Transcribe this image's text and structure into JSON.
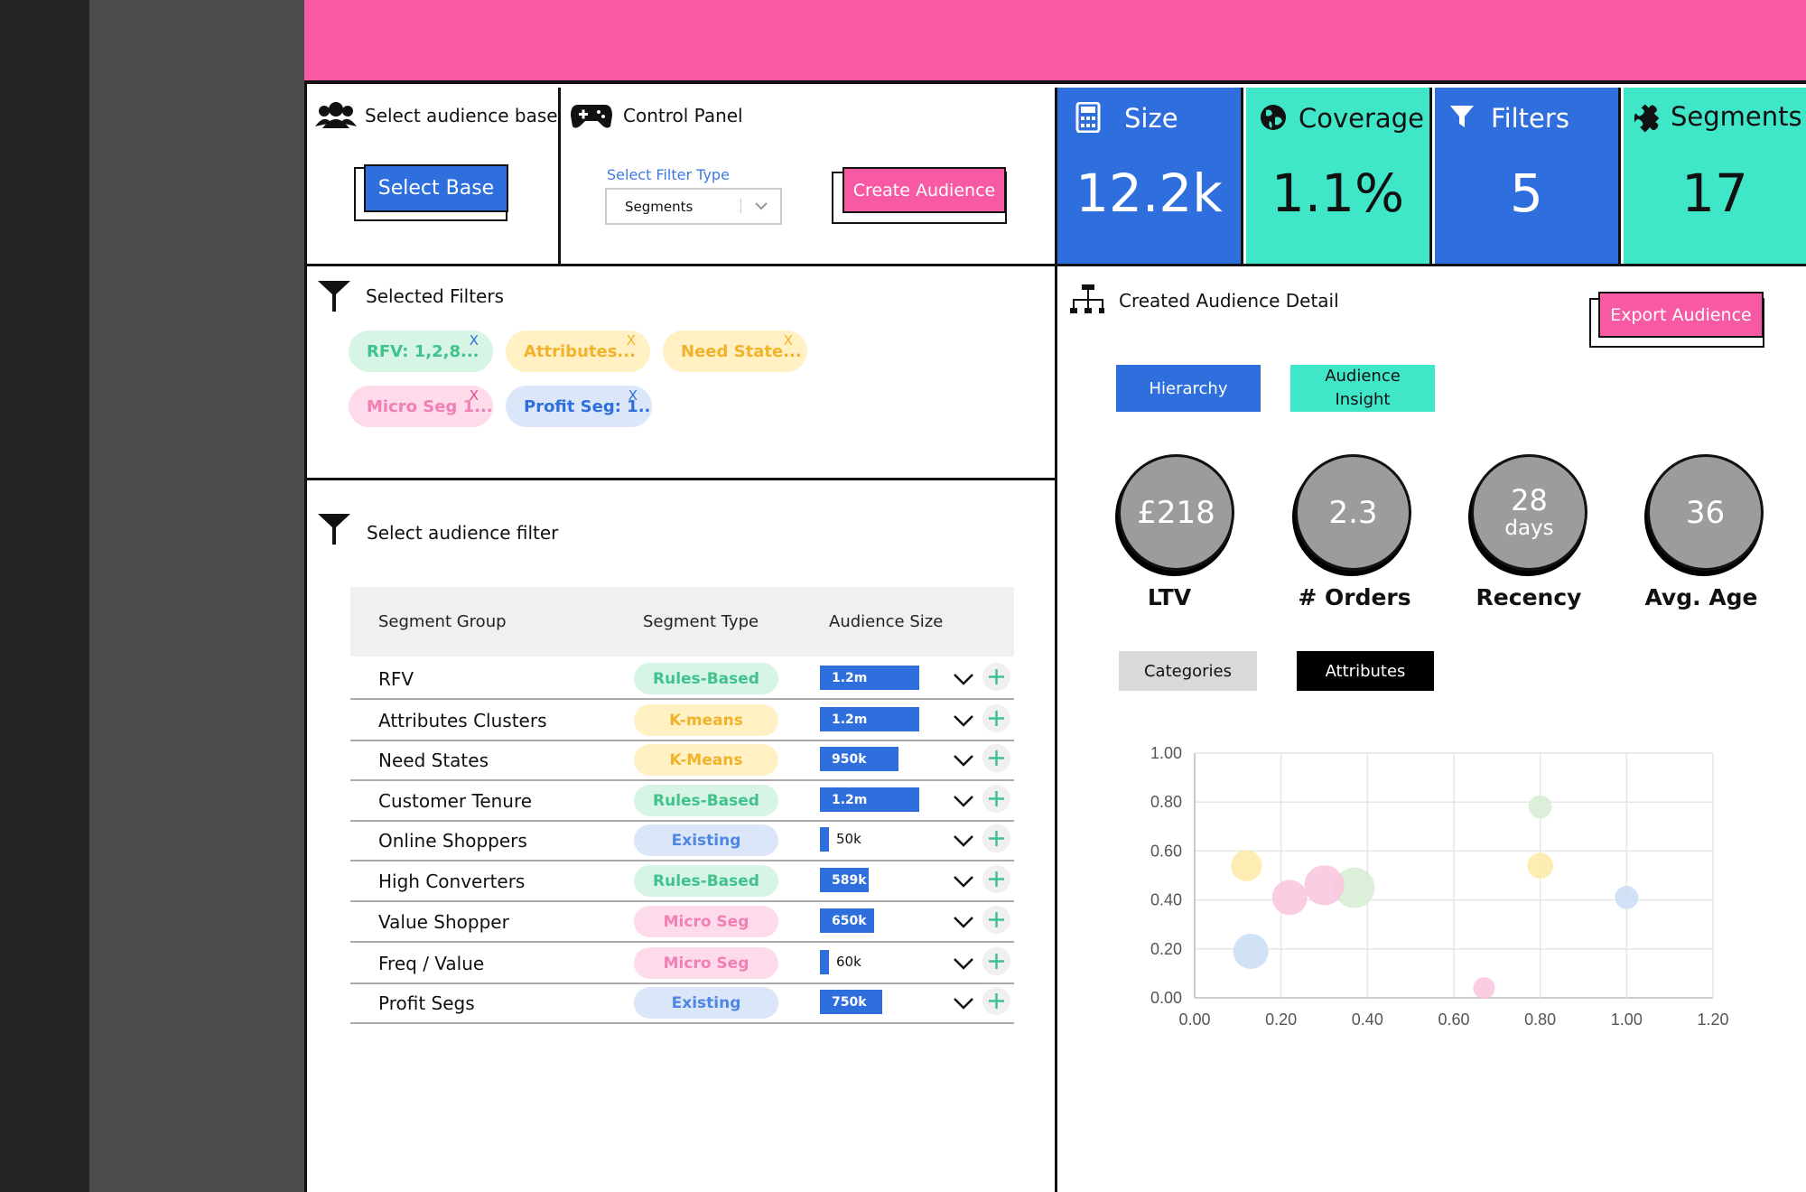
{
  "colors": {
    "accent_pink": "#f75aa3",
    "accent_blue": "#2f6fdd",
    "accent_teal": "#40e6c8",
    "green_pill": "#d7f5e4",
    "yellow_pill": "#fff1c4",
    "pink_pill": "#fddbeb",
    "blue_pill": "#dbe7f8"
  },
  "audience_base": {
    "title": "Select audience base",
    "icon": "users-icon",
    "button": "Select Base"
  },
  "control_panel": {
    "title": "Control Panel",
    "icon": "gamepad-icon",
    "filter_label": "Select Filter Type",
    "filter_value": "Segments",
    "button": "Create Audience"
  },
  "kpis": [
    {
      "label": "Size",
      "value": "12.2k",
      "icon": "calculator-icon"
    },
    {
      "label": "Coverage",
      "value": "1.1%",
      "icon": "globe-icon"
    },
    {
      "label": "Filters",
      "value": "5",
      "icon": "filter-icon"
    },
    {
      "label": "Segments",
      "value": "17",
      "icon": "puzzle-icon"
    }
  ],
  "selected_filters": {
    "title": "Selected Filters",
    "chips": [
      {
        "label": "RFV: 1,2,8...",
        "remove": "X"
      },
      {
        "label": "Attributes...",
        "remove": "X"
      },
      {
        "label": "Need State...",
        "remove": "X"
      },
      {
        "label": "Micro Seg 1...",
        "remove": "X"
      },
      {
        "label": "Profit Seg: 1..",
        "remove": "X"
      }
    ]
  },
  "audience_filter": {
    "title": "Select audience filter",
    "columns": [
      "Segment Group",
      "Segment Type",
      "Audience Size"
    ],
    "rows": [
      {
        "group": "RFV",
        "type": "Rules-Based",
        "size": "1.2m",
        "size_value": 1.2
      },
      {
        "group": "Attributes Clusters",
        "type": "K-means",
        "size": "1.2m",
        "size_value": 1.2
      },
      {
        "group": "Need States",
        "type": "K-Means",
        "size": "950k",
        "size_value": 0.95
      },
      {
        "group": "Customer Tenure",
        "type": "Rules-Based",
        "size": "1.2m",
        "size_value": 1.2
      },
      {
        "group": "Online Shoppers",
        "type": "Existing",
        "size": "50k",
        "size_value": 0.05
      },
      {
        "group": "High Converters",
        "type": "Rules-Based",
        "size": "589k",
        "size_value": 0.589
      },
      {
        "group": "Value Shopper",
        "type": "Micro Seg",
        "size": "650k",
        "size_value": 0.65
      },
      {
        "group": "Freq / Value",
        "type": "Micro Seg",
        "size": "60k",
        "size_value": 0.06
      },
      {
        "group": "Profit Segs",
        "type": "Existing",
        "size": "750k",
        "size_value": 0.75
      }
    ]
  },
  "detail": {
    "title": "Created Audience Detail",
    "icon": "hierarchy-icon",
    "export_button": "Export Audience",
    "tabs": [
      "Hierarchy",
      "Audience Insight"
    ],
    "metrics": [
      {
        "value": "£218",
        "sub": "",
        "label": "LTV"
      },
      {
        "value": "2.3",
        "sub": "",
        "label": "# Orders"
      },
      {
        "value": "28",
        "sub": "days",
        "label": "Recency"
      },
      {
        "value": "36",
        "sub": "",
        "label": "Avg. Age"
      }
    ],
    "chart_tabs": [
      "Categories",
      "Attributes"
    ]
  },
  "chart_data": {
    "type": "scatter",
    "title": "",
    "xlabel": "",
    "ylabel": "",
    "xlim": [
      0,
      1.2
    ],
    "ylim": [
      0,
      1.0
    ],
    "x_ticks": [
      "0.00",
      "0.20",
      "0.40",
      "0.60",
      "0.80",
      "1.00",
      "1.20"
    ],
    "y_ticks": [
      "0.00",
      "0.20",
      "0.40",
      "0.60",
      "0.80",
      "1.00"
    ],
    "grid": true,
    "points": [
      {
        "x": 0.13,
        "y": 0.19,
        "r": 0.068,
        "color": "#c9dcf5"
      },
      {
        "x": 0.12,
        "y": 0.54,
        "r": 0.06,
        "color": "#fdeaa6"
      },
      {
        "x": 0.37,
        "y": 0.45,
        "r": 0.078,
        "color": "#d6ecd2"
      },
      {
        "x": 0.22,
        "y": 0.41,
        "r": 0.068,
        "color": "#fac4de"
      },
      {
        "x": 0.3,
        "y": 0.46,
        "r": 0.077,
        "color": "#fac4de"
      },
      {
        "x": 0.8,
        "y": 0.78,
        "r": 0.045,
        "color": "#d6ecd2"
      },
      {
        "x": 0.8,
        "y": 0.54,
        "r": 0.05,
        "color": "#fdeaa6"
      },
      {
        "x": 1.0,
        "y": 0.41,
        "r": 0.045,
        "color": "#c9dcf5"
      },
      {
        "x": 0.67,
        "y": 0.04,
        "r": 0.042,
        "color": "#fac4de"
      }
    ]
  }
}
